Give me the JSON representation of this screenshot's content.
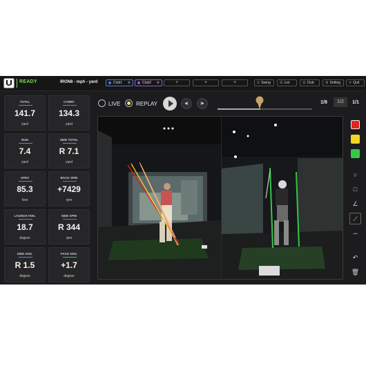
{
  "header": {
    "status": "READY",
    "title": "IRON8 - mph - yard",
    "clubs": [
      {
        "label": "Club1",
        "color": "#4a7fd4"
      },
      {
        "label": "Club2",
        "color": "#9a5cd0"
      }
    ],
    "add_slots": [
      "+",
      "+",
      "+"
    ],
    "buttons": [
      {
        "label": "Swing",
        "icon": "swing-icon"
      },
      {
        "label": "List",
        "icon": "list-icon"
      },
      {
        "label": "Club",
        "icon": "club-icon"
      },
      {
        "label": "Setting",
        "icon": "gear-icon"
      },
      {
        "label": "Quit",
        "icon": "close-icon"
      }
    ]
  },
  "metrics": [
    {
      "label": "TOTAL",
      "value": "141.7",
      "unit": "yard",
      "accent": "#4a90e2"
    },
    {
      "label": "CARRY",
      "value": "134.3",
      "unit": "yard",
      "accent": "#4a90e2"
    },
    {
      "label": "RUN",
      "value": "7.4",
      "unit": "yard",
      "accent": "#4a90e2"
    },
    {
      "label": "SIDE TOTAL",
      "value": "R 7.1",
      "unit": "yard",
      "accent": "#4a90e2"
    },
    {
      "label": "APEX",
      "value": "85.3",
      "unit": "feet",
      "accent": "#4a90e2"
    },
    {
      "label": "BACK SPIN",
      "value": "+7429",
      "unit": "rpm",
      "accent": "#9a5cd0"
    },
    {
      "label": "LAUNCH ANG.",
      "value": "18.7",
      "unit": "degree",
      "accent": "#4a90e2"
    },
    {
      "label": "SIDE SPIN",
      "value": "R 344",
      "unit": "rpm",
      "accent": "#9a5cd0"
    },
    {
      "label": "SIDE ANG.",
      "value": "R 1.5",
      "unit": "degree",
      "accent": "#4a90e2"
    },
    {
      "label": "FACE ANG.",
      "value": "+1.7",
      "unit": "degree",
      "accent": "#2ec27e"
    }
  ],
  "playback": {
    "live_label": "LIVE",
    "replay_label": "REPLAY",
    "replay_color": "#f2e27a",
    "progress": 0.45
  },
  "views": [
    "1/8",
    "1/2",
    "1/1"
  ],
  "tools": {
    "colors": [
      "#e02424",
      "#f1d52b",
      "#35c84a"
    ]
  }
}
